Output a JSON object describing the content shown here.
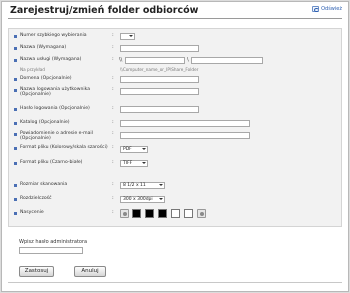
{
  "page": {
    "title": "Zarejestruj/zmień folder odbiorców",
    "refresh_label": "Odśwież"
  },
  "form": {
    "quick_number_label": "Numer szybkiego wybierania",
    "name_label": "Nazwa (Wymagana)",
    "service_name_label": "Nazwa usługi (Wymagana)",
    "service_prefix": "\\\\",
    "service_sep": "\\",
    "example_label": "Na przykład",
    "example_value": "\\\\Computer_name_or_IP\\Share_Folder",
    "domain_label": "Domena (Opcjonalnie)",
    "login_user_label": "Nazwa logowania użytkownika (Opcjonalnie)",
    "login_pass_label": "Hasło logowania (Opcjonalnie)",
    "catalog_label": "Katalog (Opcjonalnie)",
    "notify_email_label": "Powiadomienie o adresie e-mail (Opcjonalnie)",
    "file_format_color_label": "Format pliku (Kolorowy/skala szarości)",
    "file_format_color_value": "PDF",
    "file_format_bw_label": "Format pliku (Czarno-białe)",
    "file_format_bw_value": "TIFF",
    "scan_size_label": "Rozmiar skanowania",
    "scan_size_value": "8 1/2 x 11",
    "resolution_label": "Rozdzielczość",
    "resolution_value": "300 x 300dpi",
    "density_label": "Nasycenie",
    "density_swatches": [
      "#000000",
      "#000000",
      "#000000",
      "#ffffff",
      "#ffffff"
    ]
  },
  "admin": {
    "password_label": "Wpisz hasło administratora"
  },
  "buttons": {
    "apply": "Zastosuj",
    "cancel": "Anuluj"
  }
}
